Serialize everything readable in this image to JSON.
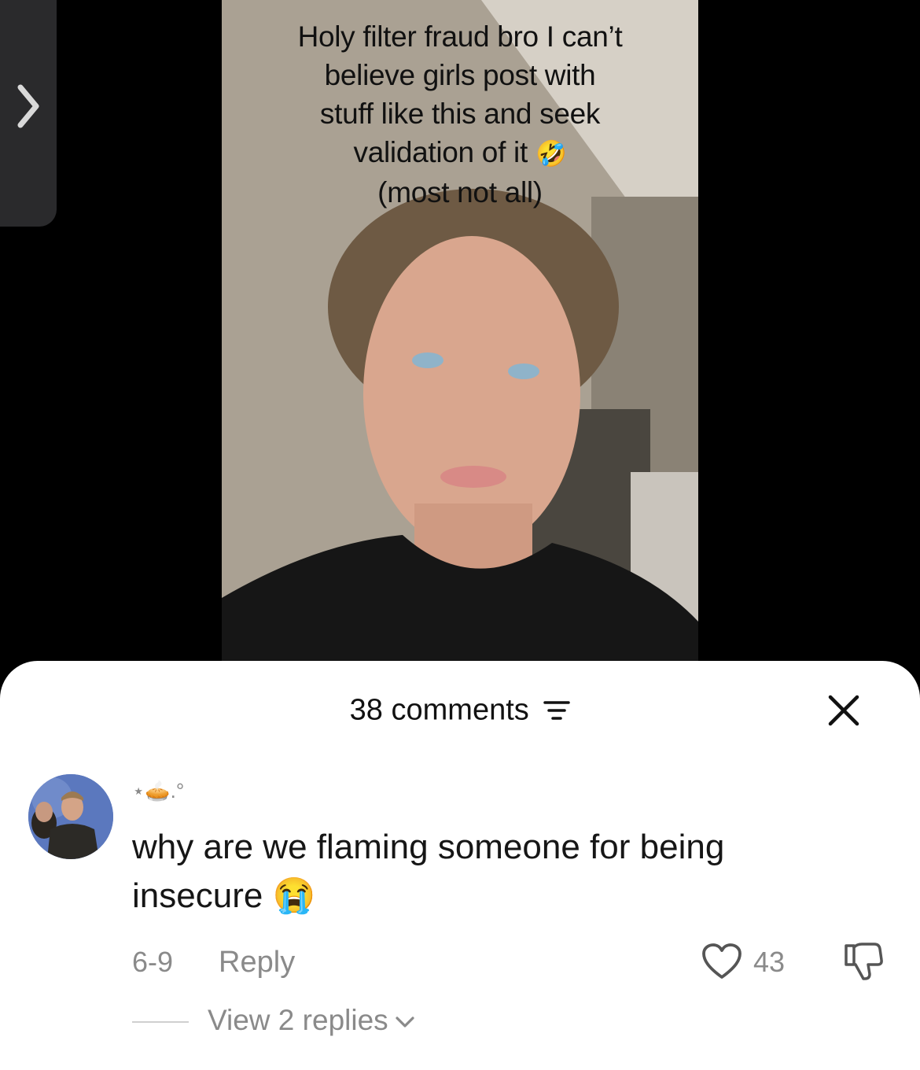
{
  "video": {
    "caption_line1": "Holy filter fraud bro I can’t",
    "caption_line2": "believe girls post with",
    "caption_line3": "stuff like this and seek",
    "caption_line4": "validation of it",
    "caption_emoji": "🤣",
    "caption_line5": "(most not all)"
  },
  "sheet": {
    "title": "38 comments",
    "filter_icon": "filter-icon",
    "close_icon": "close-icon"
  },
  "comment": {
    "username": "⋆🥧.°",
    "text": "why are we flaming someone for being insecure",
    "text_emoji": "😭",
    "date": "6-9",
    "reply_label": "Reply",
    "like_count": "43",
    "view_replies_label": "View 2 replies"
  },
  "colors": {
    "sheet_bg": "#ffffff",
    "muted_text": "#8a8a8a",
    "primary_text": "#161616"
  }
}
